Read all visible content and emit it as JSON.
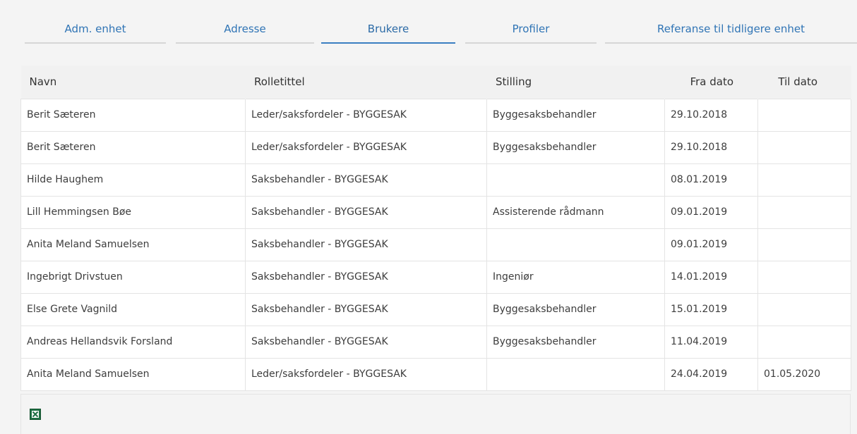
{
  "tabs": [
    {
      "label": "Adm. enhet",
      "active": false
    },
    {
      "label": "Adresse",
      "active": false
    },
    {
      "label": "Brukere",
      "active": true
    },
    {
      "label": "Profiler",
      "active": false
    },
    {
      "label": "Referanse til tidligere enhet",
      "active": false
    }
  ],
  "table": {
    "columns": {
      "navn": "Navn",
      "rolletittel": "Rolletittel",
      "stilling": "Stilling",
      "fra_dato": "Fra dato",
      "til_dato": "Til dato"
    },
    "rows": [
      {
        "navn": "Berit Sæteren",
        "rolletittel": "Leder/saksfordeler - BYGGESAK",
        "stilling": "Byggesaksbehandler",
        "fra_dato": "29.10.2018",
        "til_dato": ""
      },
      {
        "navn": "Berit Sæteren",
        "rolletittel": "Leder/saksfordeler - BYGGESAK",
        "stilling": "Byggesaksbehandler",
        "fra_dato": "29.10.2018",
        "til_dato": ""
      },
      {
        "navn": "Hilde Haughem",
        "rolletittel": "Saksbehandler - BYGGESAK",
        "stilling": "",
        "fra_dato": "08.01.2019",
        "til_dato": ""
      },
      {
        "navn": "Lill Hemmingsen Bøe",
        "rolletittel": "Saksbehandler - BYGGESAK",
        "stilling": "Assisterende rådmann",
        "fra_dato": "09.01.2019",
        "til_dato": ""
      },
      {
        "navn": "Anita Meland Samuelsen",
        "rolletittel": "Saksbehandler - BYGGESAK",
        "stilling": "",
        "fra_dato": "09.01.2019",
        "til_dato": ""
      },
      {
        "navn": "Ingebrigt Drivstuen",
        "rolletittel": "Saksbehandler - BYGGESAK",
        "stilling": "Ingeniør",
        "fra_dato": "14.01.2019",
        "til_dato": ""
      },
      {
        "navn": "Else Grete Vagnild",
        "rolletittel": "Saksbehandler - BYGGESAK",
        "stilling": "Byggesaksbehandler",
        "fra_dato": "15.01.2019",
        "til_dato": ""
      },
      {
        "navn": "Andreas Hellandsvik Forsland",
        "rolletittel": "Saksbehandler - BYGGESAK",
        "stilling": "Byggesaksbehandler",
        "fra_dato": "11.04.2019",
        "til_dato": ""
      },
      {
        "navn": "Anita Meland Samuelsen",
        "rolletittel": "Leder/saksfordeler - BYGGESAK",
        "stilling": "",
        "fra_dato": "24.04.2019",
        "til_dato": "01.05.2020"
      }
    ]
  },
  "footer": {
    "export_icon": "excel-export-icon"
  },
  "colors": {
    "tab_text": "#2f74b5",
    "tab_active_underline": "#3a7fc1",
    "tab_inactive_underline": "#d6d6d6",
    "header_bg": "#f1f1f1",
    "cell_border": "#e4e4e4",
    "excel_green": "#1e7145"
  }
}
